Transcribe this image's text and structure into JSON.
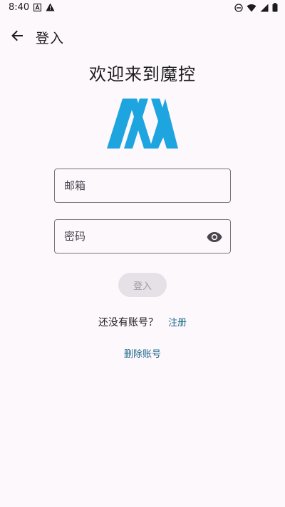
{
  "status_bar": {
    "time": "8:40"
  },
  "appbar": {
    "title": "登入"
  },
  "welcome": {
    "heading": "欢迎来到魔控"
  },
  "form": {
    "email_placeholder": "邮箱",
    "email_value": "",
    "password_placeholder": "密码",
    "password_value": "",
    "login_label": "登入"
  },
  "register": {
    "prompt": "还没有账号？",
    "link": "注册"
  },
  "delete_account": {
    "label": "删除账号"
  },
  "colors": {
    "background": "#fdf8fc",
    "accent": "#1e6a8a",
    "logo": "#1ea5e0",
    "button_disabled": "#e5e1e6"
  },
  "icons": {
    "back": "arrow-back-icon",
    "visibility": "eye-icon",
    "logo": "logo-m-icon"
  }
}
